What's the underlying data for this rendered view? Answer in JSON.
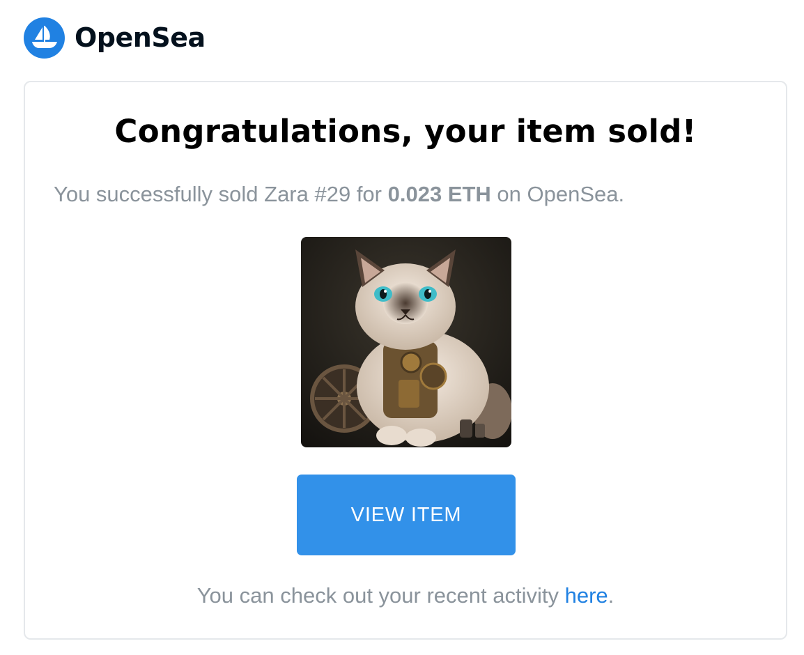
{
  "brand": {
    "name": "OpenSea",
    "logo_icon": "opensea-sailboat-icon",
    "accent_color": "#2081e2"
  },
  "email": {
    "title": "Congratulations, your item sold!",
    "message": {
      "prefix": "You successfully sold Zara #29 for ",
      "price": "0.023 ETH",
      "suffix": " on OpenSea."
    },
    "image": {
      "description_icon": "nft-cat-image"
    },
    "button_label": "VIEW ITEM",
    "button_color": "#3291e9",
    "footer": {
      "prefix": "You can check out your recent activity ",
      "link": "here",
      "suffix": "."
    }
  }
}
